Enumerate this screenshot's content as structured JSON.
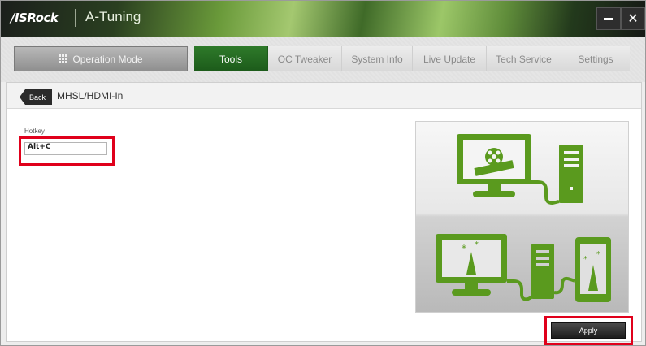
{
  "window": {
    "logo_text": "/ISRock",
    "app_title": "A-Tuning",
    "minimize_label": "—",
    "close_label": "✕"
  },
  "nav": {
    "operation_mode": "Operation Mode",
    "tabs": [
      {
        "label": "Tools",
        "active": true
      },
      {
        "label": "OC Tweaker",
        "active": false
      },
      {
        "label": "System Info",
        "active": false
      },
      {
        "label": "Live Update",
        "active": false
      },
      {
        "label": "Tech Service",
        "active": false
      },
      {
        "label": "Settings",
        "active": false
      }
    ]
  },
  "page": {
    "back_label": "Back",
    "title": "MHSL/HDMI-In"
  },
  "hotkey": {
    "label": "Hotkey",
    "value": "Alt+C"
  },
  "actions": {
    "apply_label": "Apply"
  },
  "colors": {
    "accent_green": "#2e7a2a",
    "illustration_green": "#5a9a1e",
    "highlight_red": "#e0001b"
  },
  "icons": {
    "illustration": "pc-monitor-film-tower-tablet",
    "operation_mode": "grid-icon"
  }
}
